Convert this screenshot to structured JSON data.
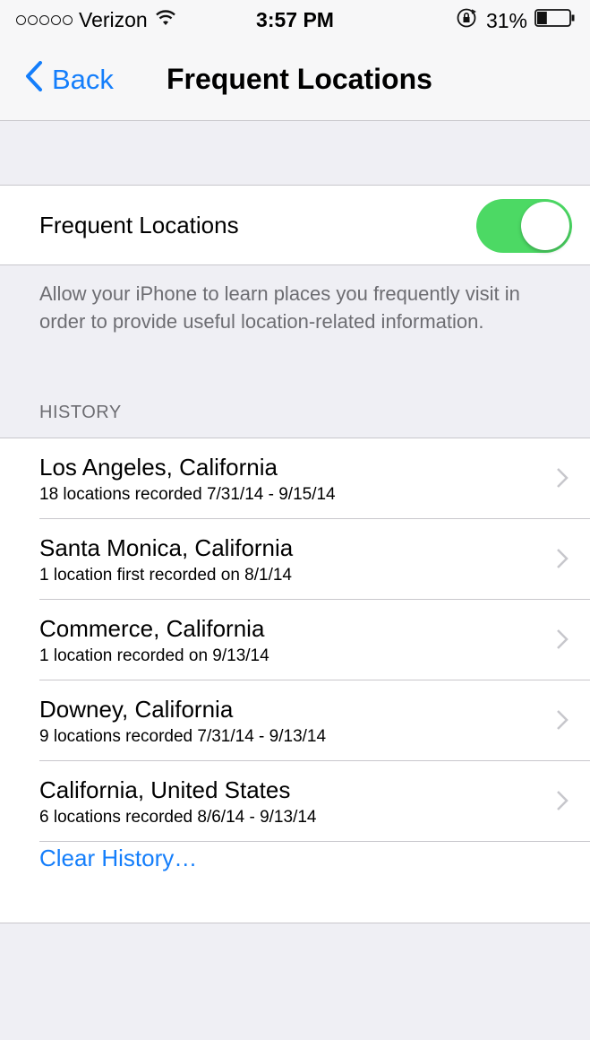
{
  "status_bar": {
    "carrier": "Verizon",
    "time": "3:57 PM",
    "battery_percent": "31%",
    "battery_level": 0.31,
    "signal_icon": "signal-dots-icon",
    "wifi_icon": "wifi-icon",
    "rotation_lock_icon": "rotation-lock-icon"
  },
  "nav": {
    "back_label": "Back",
    "title": "Frequent Locations",
    "accent_color": "#147efb"
  },
  "toggle": {
    "label": "Frequent Locations",
    "on": true,
    "on_color": "#4cd964"
  },
  "footer_text": "Allow your iPhone to learn places you frequently visit in order to provide useful location-related information.",
  "history": {
    "header": "HISTORY",
    "items": [
      {
        "title": "Los Angeles, California",
        "subtitle": "18 locations recorded 7/31/14 - 9/15/14"
      },
      {
        "title": "Santa Monica, California",
        "subtitle": "1 location first recorded on 8/1/14"
      },
      {
        "title": "Commerce, California",
        "subtitle": "1 location recorded on 9/13/14"
      },
      {
        "title": "Downey, California",
        "subtitle": "9 locations recorded 7/31/14 - 9/13/14"
      },
      {
        "title": "California, United States",
        "subtitle": "6 locations recorded 8/6/14 - 9/13/14"
      }
    ],
    "clear_label": "Clear History…"
  }
}
